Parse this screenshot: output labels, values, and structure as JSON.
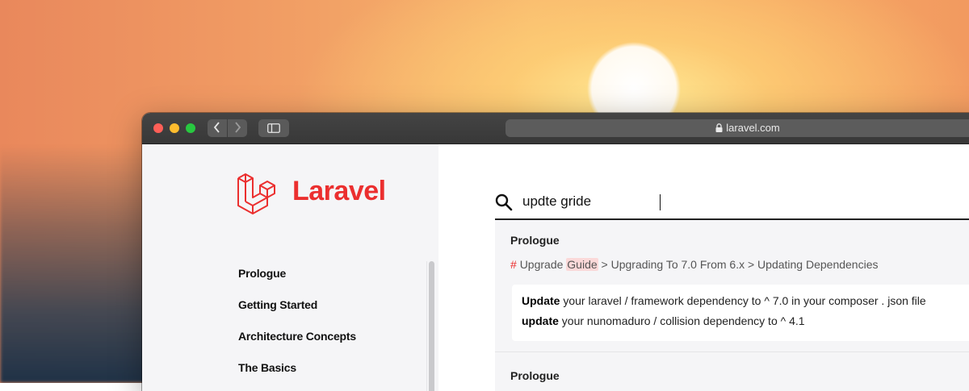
{
  "browser": {
    "url": "laravel.com"
  },
  "brand": {
    "name": "Laravel",
    "color": "#eb2f2f"
  },
  "sidebar": {
    "items": [
      {
        "label": "Prologue"
      },
      {
        "label": "Getting Started"
      },
      {
        "label": "Architecture Concepts"
      },
      {
        "label": "The Basics"
      }
    ]
  },
  "search": {
    "value": "updte gride"
  },
  "results": [
    {
      "section": "Prologue",
      "breadcrumb_hash": "#",
      "breadcrumb_pre": "Upgrade",
      "breadcrumb_match": "Guide",
      "breadcrumb_post": "> Upgrading To 7.0 From 6.x > Updating Dependencies",
      "line1_strong": "Update",
      "line1_rest": "your laravel / framework dependency to ^ 7.0 in your composer . json file",
      "line2_strong": "update",
      "line2_rest": "your nunomaduro / collision dependency to ^ 4.1"
    },
    {
      "section": "Prologue"
    }
  ]
}
